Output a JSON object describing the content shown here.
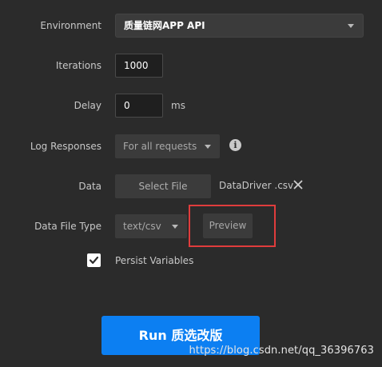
{
  "environment": {
    "label": "Environment",
    "value": "质量链网APP API",
    "caret_icon": "chevron-down-icon"
  },
  "iterations": {
    "label": "Iterations",
    "value": "1000"
  },
  "delay": {
    "label": "Delay",
    "value": "0",
    "unit": "ms"
  },
  "log_responses": {
    "label": "Log Responses",
    "value": "For all requests",
    "info_icon": "info-icon",
    "info_glyph": "i"
  },
  "data": {
    "label": "Data",
    "select_file_label": "Select File",
    "file_name": "DataDriver .csv",
    "remove_icon": "close-icon"
  },
  "data_file_type": {
    "label": "Data File Type",
    "value": "text/csv",
    "preview_label": "Preview"
  },
  "persist_variables": {
    "label": "Persist Variables",
    "checked": true
  },
  "run_button": {
    "label": "Run 质选改版"
  },
  "watermark": "https://blog.csdn.net/qq_36396763",
  "colors": {
    "background": "#2b2b2b",
    "primary": "#0c7ff2",
    "highlight_box": "#e03c3c"
  }
}
